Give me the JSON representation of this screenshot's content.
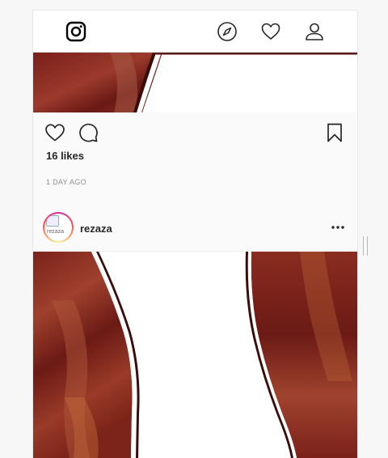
{
  "navbar": {
    "icons": [
      "instagram-logo-icon",
      "compass-icon",
      "heart-icon",
      "user-icon"
    ]
  },
  "post1": {
    "likes": "16 likes",
    "time": "1 DAY AGO",
    "icons": [
      "heart-icon",
      "comment-icon",
      "bookmark-icon"
    ]
  },
  "post2": {
    "username": "rezaza",
    "avatar_alt": "rezaza",
    "more_icon": "more-horizontal-icon"
  },
  "colors": {
    "accent_dark_red": "#5e1a17",
    "text": "#262626",
    "muted": "#8e8e8e"
  }
}
